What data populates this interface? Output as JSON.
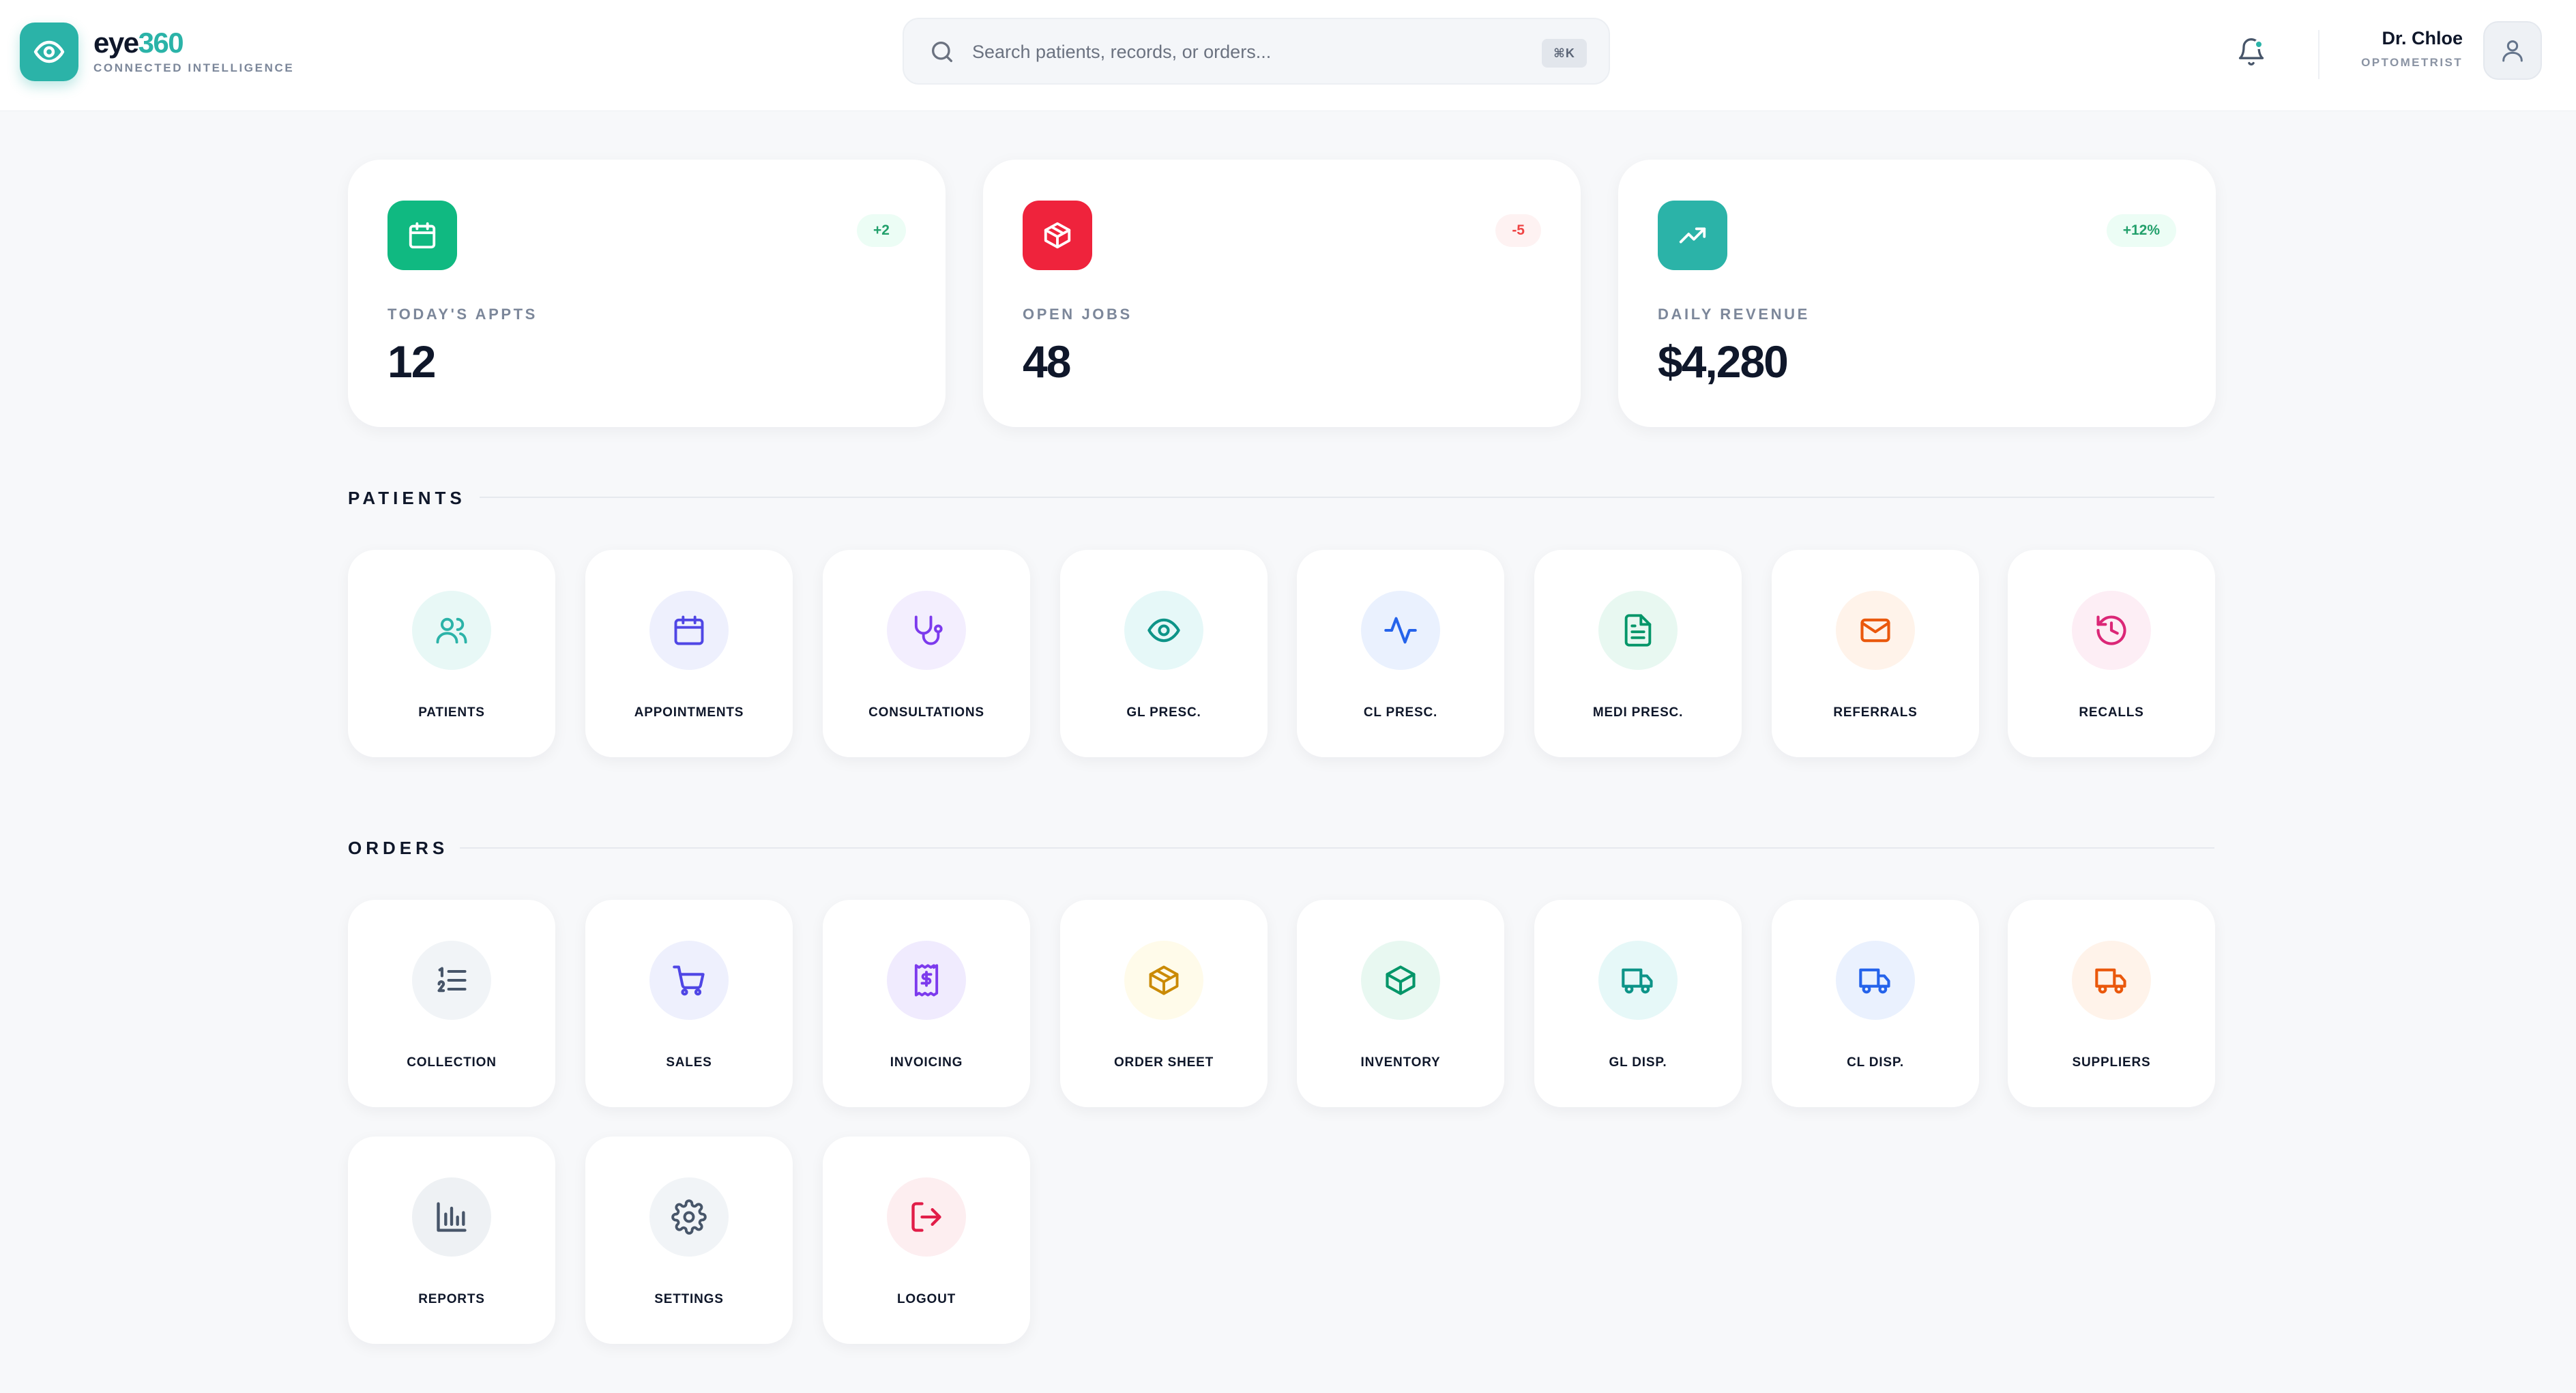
{
  "brand": {
    "name_main": "eye",
    "name_accent": "360",
    "tagline": "CONNECTED INTELLIGENCE",
    "accent_color": "#2bb3a8"
  },
  "search": {
    "placeholder": "Search patients, records, or orders...",
    "value": "",
    "shortcut": "⌘K"
  },
  "header": {
    "notification_icon": "bell-icon",
    "user_name": "Dr. Chloe",
    "user_role": "OPTOMETRIST",
    "avatar_icon": "user-icon"
  },
  "stats": [
    {
      "label": "TODAY'S APPTS",
      "value": "12",
      "badge": "+2",
      "icon": "calendar-icon",
      "color": "#10b981",
      "badge_color": "#22a06b",
      "badge_bg": "#ecfdf5"
    },
    {
      "label": "OPEN JOBS",
      "value": "48",
      "badge": "-5",
      "icon": "box-icon",
      "color": "#ef233c",
      "badge_color": "#ef4444",
      "badge_bg": "#fef2f2"
    },
    {
      "label": "DAILY REVENUE",
      "value": "$4,280",
      "badge": "+12%",
      "icon": "trending-up-icon",
      "color": "#2bb3a8",
      "badge_color": "#22a06b",
      "badge_bg": "#ecfdf5"
    }
  ],
  "patients": {
    "title": "PATIENTS",
    "items": [
      {
        "label": "PATIENTS",
        "icon": "users-icon",
        "color": "#2bb3a8",
        "bg": "#e8f8f6"
      },
      {
        "label": "APPOINTMENTS",
        "icon": "calendar-icon",
        "color": "#4f46e5",
        "bg": "#eef0fd"
      },
      {
        "label": "CONSULTATIONS",
        "icon": "stethoscope-icon",
        "color": "#7c3aed",
        "bg": "#f3eefe"
      },
      {
        "label": "GL PRESC.",
        "icon": "eye-icon",
        "color": "#0d9488",
        "bg": "#e6f8f8"
      },
      {
        "label": "CL PRESC.",
        "icon": "activity-icon",
        "color": "#2563eb",
        "bg": "#eaf1fe"
      },
      {
        "label": "MEDI PRESC.",
        "icon": "file-text-icon",
        "color": "#059669",
        "bg": "#e8f8f1"
      },
      {
        "label": "REFERRALS",
        "icon": "mail-icon",
        "color": "#ea580c",
        "bg": "#fff3ea"
      },
      {
        "label": "RECALLS",
        "icon": "history-icon",
        "color": "#db2777",
        "bg": "#fdeef5"
      }
    ]
  },
  "orders": {
    "title": "ORDERS",
    "items": [
      {
        "label": "COLLECTION",
        "icon": "list-ordered-icon",
        "color": "#475569",
        "bg": "#f1f4f7"
      },
      {
        "label": "SALES",
        "icon": "cart-icon",
        "color": "#4f46e5",
        "bg": "#eef0fd"
      },
      {
        "label": "INVOICING",
        "icon": "receipt-icon",
        "color": "#7c3aed",
        "bg": "#f0ebfe"
      },
      {
        "label": "ORDER SHEET",
        "icon": "package-icon",
        "color": "#ca8a04",
        "bg": "#fffbea"
      },
      {
        "label": "INVENTORY",
        "icon": "box-icon",
        "color": "#059669",
        "bg": "#e8f8f1"
      },
      {
        "label": "GL DISP.",
        "icon": "truck-icon",
        "color": "#0d9488",
        "bg": "#e6f8f8"
      },
      {
        "label": "CL DISP.",
        "icon": "truck-icon",
        "color": "#2563eb",
        "bg": "#eaf1fe"
      },
      {
        "label": "SUPPLIERS",
        "icon": "truck-icon",
        "color": "#ea580c",
        "bg": "#fff3ea"
      },
      {
        "label": "REPORTS",
        "icon": "bar-chart-icon",
        "color": "#475569",
        "bg": "#eef1f4"
      },
      {
        "label": "SETTINGS",
        "icon": "gear-icon",
        "color": "#475569",
        "bg": "#f1f4f7"
      },
      {
        "label": "LOGOUT",
        "icon": "logout-icon",
        "color": "#e11d48",
        "bg": "#fdeef0"
      }
    ]
  }
}
